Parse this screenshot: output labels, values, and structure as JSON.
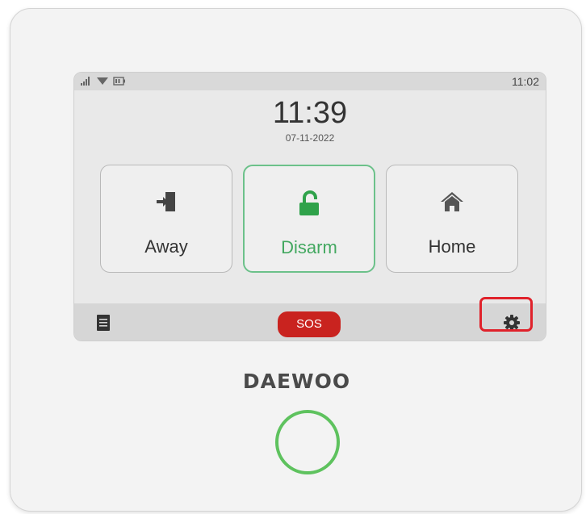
{
  "status_bar": {
    "time": "11:02",
    "icons": [
      "signal-icon",
      "wifi-icon",
      "battery-icon"
    ]
  },
  "clock": {
    "time": "11:39",
    "date": "07-11-2022"
  },
  "modes": [
    {
      "label": "Away",
      "icon": "away-exit-icon",
      "active": false
    },
    {
      "label": "Disarm",
      "icon": "unlock-icon",
      "active": true
    },
    {
      "label": "Home",
      "icon": "home-icon",
      "active": false
    }
  ],
  "bottom_bar": {
    "sos_label": "SOS",
    "left_icon": "event-log-icon",
    "right_icon": "gear-icon"
  },
  "brand": "DAEWOO",
  "colors": {
    "accent_green": "#43a860",
    "sos_red": "#c9231f",
    "highlight_red": "#e0222b",
    "ring_green": "#5ec25e"
  }
}
